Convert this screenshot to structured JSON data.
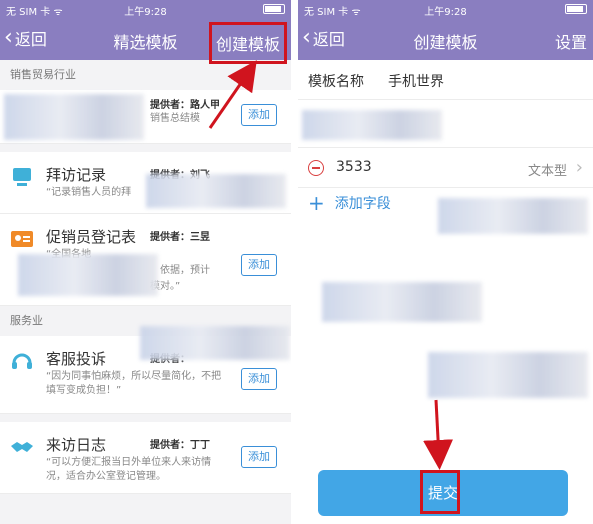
{
  "left": {
    "status": {
      "carrier": "无 SIM 卡 ᯤ",
      "time": "上午9:28"
    },
    "nav": {
      "back": "返回",
      "title": "精选模板",
      "action": "创建模板"
    },
    "sections": [
      {
        "title": "销售贸易行业"
      },
      {
        "title": "服务业"
      }
    ],
    "items": [
      {
        "name": "",
        "provider": "提供者：路人甲",
        "desc": "销售总结模",
        "add": "添加"
      },
      {
        "name": "拜访记录",
        "provider": "提供者：刘飞",
        "desc": "“记录销售人员的拜",
        "add": ""
      },
      {
        "name": "促销员登记表",
        "provider": "提供者：三昱",
        "desc": "“全国各地",
        "desc2": "依据，预计",
        "desc3": "模对。”",
        "add": "添加"
      },
      {
        "name": "客服投诉",
        "provider": "提供者：",
        "desc": "“因为同事怕麻烦，所以尽量简化，不把填写变成负担！”",
        "add": "添加"
      },
      {
        "name": "来访日志",
        "provider": "提供者：丁丁",
        "desc": "“可以方便汇报当日外单位来人来访情况，适合办公室登记管理。",
        "add": "添加"
      }
    ],
    "icons": {
      "visit": "monitor-icon",
      "promoter": "id-card-icon",
      "service": "headset-icon",
      "guest": "handshake-icon"
    }
  },
  "right": {
    "status": {
      "carrier": "无 SIM 卡 ᯤ",
      "time": "上午9:28"
    },
    "nav": {
      "back": "返回",
      "title": "创建模板",
      "action": "设置"
    },
    "form": {
      "name_label": "模板名称",
      "name_value": "手机世界",
      "field_value": "3533",
      "field_type": "文本型",
      "add_field": "添加字段"
    },
    "submit": "提交"
  },
  "colors": {
    "nav": "#8a7ec0",
    "accent": "#3a8fd8",
    "highlight": "#d0141e",
    "submit": "#42a6e6"
  }
}
